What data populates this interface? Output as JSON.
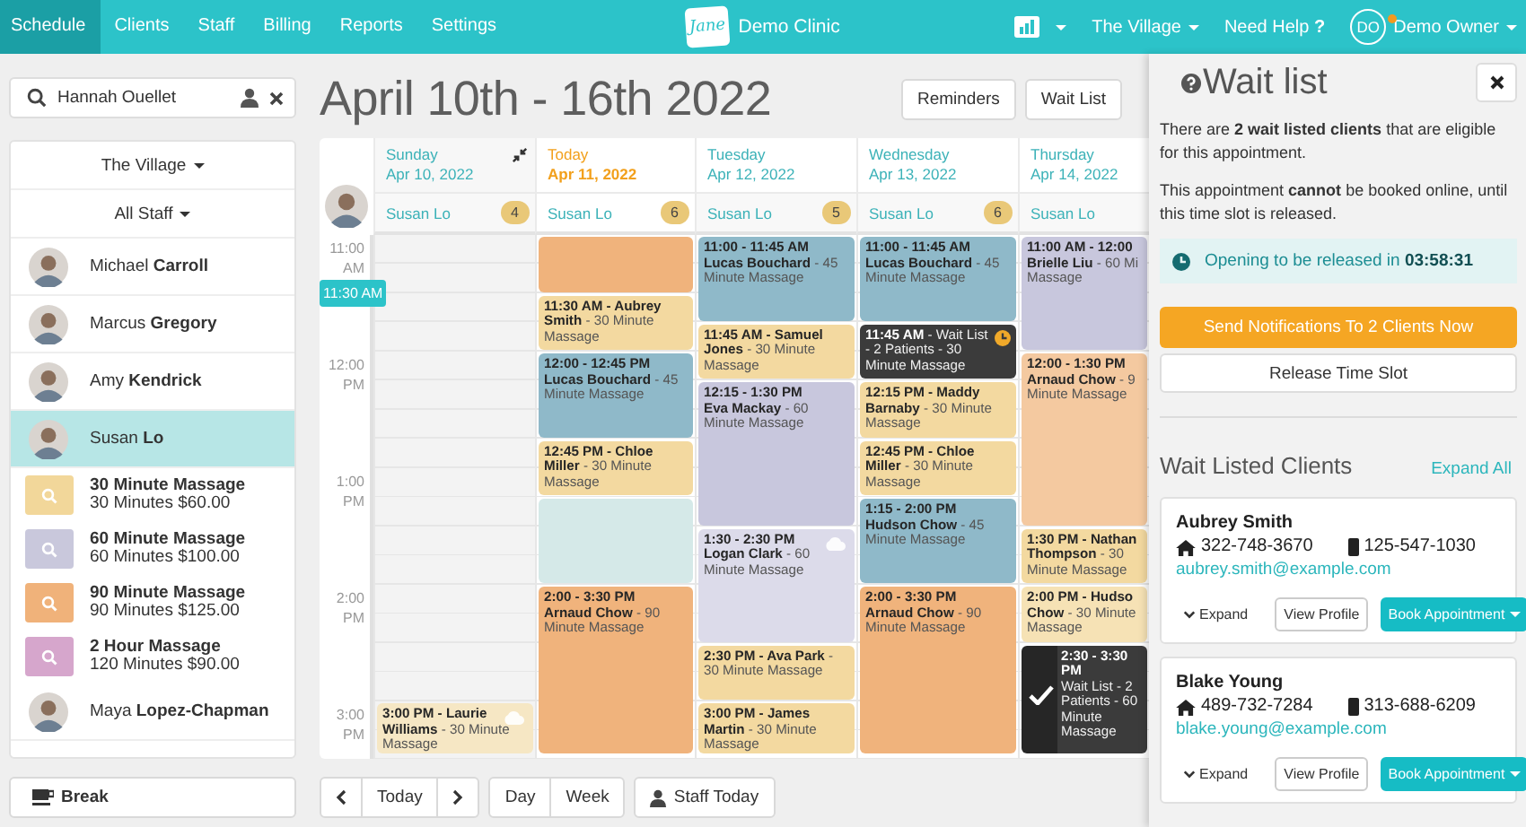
{
  "nav": {
    "items": [
      {
        "label": "Schedule",
        "selected": true
      },
      {
        "label": "Clients",
        "selected": false
      },
      {
        "label": "Staff",
        "selected": false
      },
      {
        "label": "Billing",
        "selected": false
      },
      {
        "label": "Reports",
        "selected": false
      },
      {
        "label": "Settings",
        "selected": false
      }
    ],
    "brand": {
      "logo": "Jane",
      "name": "Demo Clinic"
    },
    "location": "The Village",
    "help": "Need Help **?**",
    "user": {
      "initials": "DO",
      "name": "Demo Owner",
      "notification": true
    }
  },
  "search": {
    "value": "Hannah Ouellet"
  },
  "staff_panel": {
    "location": "The Village",
    "staff_filter": "All Staff",
    "rows": [
      {
        "kind": "staff",
        "first": "Michael",
        "last": "Carroll",
        "selected": false
      },
      {
        "kind": "staff",
        "first": "Marcus",
        "last": "Gregory",
        "selected": false
      },
      {
        "kind": "staff",
        "first": "Amy",
        "last": "Kendrick",
        "selected": false
      },
      {
        "kind": "staff",
        "first": "Susan",
        "last": "Lo",
        "selected": true
      },
      {
        "kind": "service",
        "name": "30 Minute Massage",
        "detail": "30 Minutes $60.00",
        "color": "#f2d79a",
        "selected": false
      },
      {
        "kind": "service",
        "name": "60 Minute Massage",
        "detail": "60 Minutes $100.00",
        "color": "#c9c8dc",
        "selected": false
      },
      {
        "kind": "service",
        "name": "90 Minute Massage",
        "detail": "90 Minutes $125.00",
        "color": "#f0b27a",
        "selected": false
      },
      {
        "kind": "service",
        "name": "2 Hour Massage",
        "detail": "120 Minutes $90.00",
        "color": "#d6a6cc",
        "selected": false
      },
      {
        "kind": "staff",
        "first": "Maya",
        "last": "Lopez-Chapman",
        "selected": false
      }
    ]
  },
  "break_button": "Break",
  "title": "April 10th - 16th 2022",
  "toolbar": [
    "Reminders",
    "Wait List"
  ],
  "calendar": {
    "now": "11:30 AM",
    "times": [
      {
        "hour": "11:00",
        "period": "AM"
      },
      {
        "hour": "12:00",
        "period": "PM"
      },
      {
        "hour": "1:00",
        "period": "PM"
      },
      {
        "hour": "2:00",
        "period": "PM"
      },
      {
        "hour": "3:00",
        "period": "PM"
      }
    ],
    "days": [
      {
        "name": "Sunday",
        "date": "Apr 10, 2022",
        "today": false,
        "collapsible": true,
        "staff": "Susan Lo",
        "count": "4",
        "events": [
          {
            "kind": "booking",
            "color": "#f6e7c4",
            "online": true,
            "text": "**3:00 PM - Laurie Williams** - 30 Minute Massage"
          }
        ]
      },
      {
        "name": "Today",
        "date": "Apr 11, 2022",
        "today": true,
        "collapsible": false,
        "staff": "Susan Lo",
        "count": "6",
        "events": [
          {
            "kind": "booking",
            "color": "#f0b37c",
            "online": false
          },
          {
            "kind": "booking",
            "color": "#f3d9a0",
            "online": false,
            "text": "**11:30 AM - Aubrey Smith** - 30 Minute Massage"
          },
          {
            "kind": "booking",
            "color": "#8fb9c9",
            "online": false,
            "text": "**12:00 - 12:45 PM**\n**Lucas Bouchard** - 45 Minute Massage"
          },
          {
            "kind": "booking",
            "color": "#f3d9a0",
            "online": false,
            "text": "**12:45 PM - Chloe Miller** - 30 Minute Massage"
          },
          {
            "kind": "slot"
          },
          {
            "kind": "booking",
            "color": "#f0b37c",
            "online": false,
            "text": "**2:00 - 3:30 PM**\n**Arnaud Chow** - 90 Minute Massage"
          }
        ]
      },
      {
        "name": "Tuesday",
        "date": "Apr 12, 2022",
        "today": false,
        "collapsible": false,
        "staff": "Susan Lo",
        "count": "5",
        "events": [
          {
            "kind": "booking",
            "color": "#8fb9c9",
            "online": false,
            "text": "**11:00 - 11:45 AM**\n**Lucas Bouchard** - 45 Minute Massage"
          },
          {
            "kind": "booking",
            "color": "#f3d9a0",
            "online": false,
            "text": "**11:45 AM - Samuel Jones** - 30 Minute Massage"
          },
          {
            "kind": "booking",
            "color": "#c8c7dd",
            "online": false,
            "text": "**12:15 - 1:30 PM**\n**Eva Mackay** - 60 Minute Massage"
          },
          {
            "kind": "booking",
            "color": "#dcdbea",
            "online": true,
            "text": "**1:30 - 2:30 PM**\n**Logan Clark** - 60 Minute Massage"
          },
          {
            "kind": "booking",
            "color": "#f3d9a0",
            "online": false,
            "text": "**2:30 PM - Ava Park** - 30 Minute Massage"
          },
          {
            "kind": "booking",
            "color": "#f3d9a0",
            "online": false,
            "text": "**3:00 PM - James Martin** - 30 Minute Massage"
          }
        ]
      },
      {
        "name": "Wednesday",
        "date": "Apr 13, 2022",
        "today": false,
        "collapsible": false,
        "staff": "Susan Lo",
        "count": "6",
        "events": [
          {
            "kind": "booking",
            "color": "#8fb9c9",
            "online": false,
            "text": "**11:00 - 11:45 AM**\n**Lucas Bouchard** - 45 Minute Massage"
          },
          {
            "kind": "waitlist",
            "confirmed": false,
            "text": "**11:45 AM** - Wait List - 2 Patients - 30 Minute Massage"
          },
          {
            "kind": "booking",
            "color": "#f3d9a0",
            "online": false,
            "text": "**12:15 PM - Maddy Barnaby** - 30 Minute Massage"
          },
          {
            "kind": "booking",
            "color": "#f3d9a0",
            "online": false,
            "text": "**12:45 PM - Chloe Miller** - 30 Minute Massage"
          },
          {
            "kind": "booking",
            "color": "#8fb9c9",
            "online": false,
            "text": "**1:15 - 2:00 PM**\n**Hudson Chow** - 45 Minute Massage"
          },
          {
            "kind": "booking",
            "color": "#f0b37c",
            "online": false,
            "text": "**2:00 - 3:30 PM**\n**Arnaud Chow** - 90 Minute Massage"
          }
        ]
      },
      {
        "name": "Thursday",
        "date": "Apr 14, 2022",
        "today": false,
        "collapsible": false,
        "staff": "Susan Lo",
        "events": [
          {
            "kind": "booking",
            "color": "#c8c7dd",
            "online": false,
            "text": "**11:00 AM - 12:00**\n**Brielle Liu** - 60 Mi\nMassage"
          },
          {
            "kind": "booking",
            "color": "#f4c9a0",
            "online": false,
            "text": "**12:00 - 1:30 PM**\n**Arnaud Chow** - 9\nMinute Massage"
          },
          {
            "kind": "booking",
            "color": "#f3d9a0",
            "online": false,
            "text": "**1:30 PM - Nathan**\n**Thompson** - 30\nMinute Massage"
          },
          {
            "kind": "booking",
            "color": "#f6e2b5",
            "online": false,
            "text": "**2:00 PM - Hudso**\n**Chow** - 30 Minute\nMassage"
          },
          {
            "kind": "waitlist",
            "confirmed": true,
            "text": "**2:30 - 3:30 PM**\nWait List - 2 Patients - 60 Minute Massage"
          }
        ]
      }
    ]
  },
  "footer": {
    "today": "Today",
    "views": [
      "Day",
      "Week"
    ],
    "staff_today": "Staff Today"
  },
  "wait_list": {
    "title": "Wait list",
    "message": "There are **2 wait listed clients** that are eligible for this appointment.",
    "notice": "This appointment **cannot** be booked online, until this time slot is released.",
    "countdown": "Opening to be released in **03:58:31**",
    "notify_button": "Send Notifications To 2 Clients Now",
    "release_button": "Release Time Slot",
    "clients_heading": "Wait Listed Clients",
    "expand_all": "Expand All",
    "clients": [
      {
        "name": "Aubrey Smith",
        "home_phone": "322-748-3670",
        "mobile_phone": "125-547-1030",
        "email": "aubrey.smith@example.com",
        "expand": "Expand",
        "profile": "View Profile",
        "book": "Book Appointment"
      },
      {
        "name": "Blake Young",
        "home_phone": "489-732-7284",
        "mobile_phone": "313-688-6209",
        "email": "blake.young@example.com",
        "expand": "Expand",
        "profile": "View Profile",
        "book": "Book Appointment"
      }
    ]
  }
}
